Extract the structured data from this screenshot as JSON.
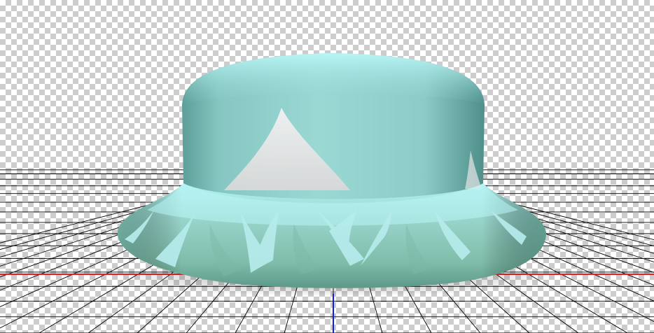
{
  "viewport": {
    "background": "transparency-checkerboard",
    "checker_colors": [
      "#ffffff",
      "#cccccc"
    ]
  },
  "ground_grid": {
    "line_color": "#000000",
    "x_axis_color": "#e02020",
    "y_axis_color": "#1020e0"
  },
  "model": {
    "object": "hat",
    "base_color": "#8fcfc8",
    "highlight_color": "#b8f4f4",
    "brim_color": "#88c4b4",
    "pattern": "white-spikes",
    "pattern_color": "#ececec"
  }
}
